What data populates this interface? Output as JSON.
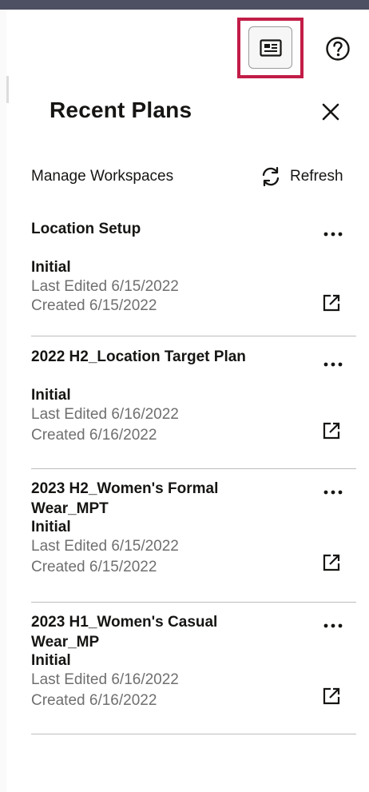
{
  "header": {
    "panel_toggle_icon": "panel-card-icon",
    "help_icon": "help-circle-icon"
  },
  "panel": {
    "title": "Recent Plans",
    "close_icon": "close-icon",
    "manage_label": "Manage Workspaces",
    "refresh_label": "Refresh",
    "refresh_icon": "refresh-icon"
  },
  "plans": [
    {
      "name": "Location Setup",
      "state": "Initial",
      "last_edited": "Last Edited 6/15/2022",
      "created": "Created 6/15/2022"
    },
    {
      "name": "2022 H2_Location Target Plan",
      "state": "Initial",
      "last_edited": "Last Edited 6/16/2022",
      "created": "Created 6/16/2022"
    },
    {
      "name": "2023 H2_Women's Formal Wear_MPT",
      "state": "Initial",
      "last_edited": "Last Edited 6/15/2022",
      "created": "Created 6/15/2022"
    },
    {
      "name": "2023 H1_Women's Casual Wear_MP",
      "state": "Initial",
      "last_edited": "Last Edited 6/16/2022",
      "created": "Created 6/16/2022"
    }
  ],
  "colors": {
    "top_bar": "#4d4f62",
    "highlight": "#c21d47",
    "muted_text": "#6f6f6f",
    "divider": "#bdbdbd"
  }
}
